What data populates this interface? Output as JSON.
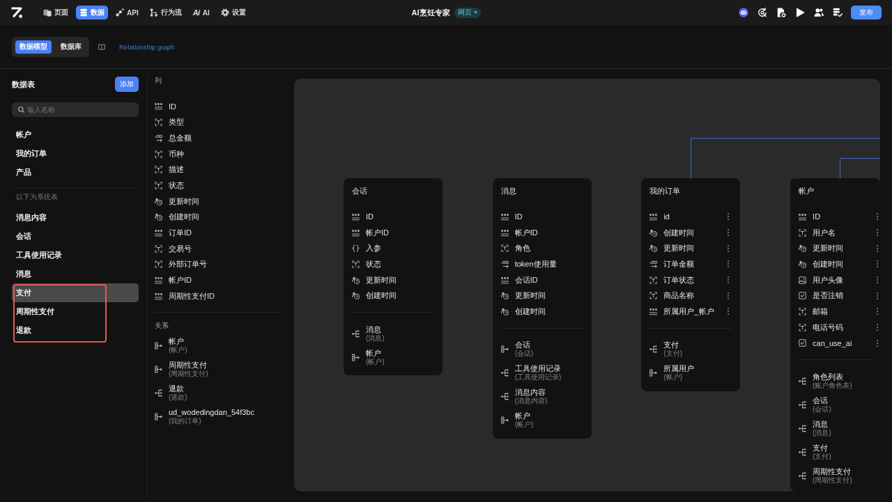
{
  "nav": [
    {
      "kind": "pages",
      "label": "页面",
      "selected": false
    },
    {
      "kind": "data",
      "label": "数据",
      "selected": true
    },
    {
      "kind": "api",
      "label": "API",
      "selected": false
    },
    {
      "kind": "flow",
      "label": "行为流",
      "selected": false
    },
    {
      "kind": "ai",
      "glyph": "Ai",
      "label": "AI",
      "selected": false
    },
    {
      "kind": "settings",
      "label": "设置",
      "selected": false
    }
  ],
  "app": {
    "title": "AI烹饪专家",
    "mode": "网页",
    "publish_button": "发布"
  },
  "view_switch": [
    {
      "label": "数据模型",
      "selected": true
    },
    {
      "label": "数据库",
      "selected": false
    }
  ],
  "graph_link": "Relationship graph",
  "sidebar": {
    "title": "数据表",
    "add_button": "添加",
    "search_placeholder": "输入名称",
    "tables": [
      {
        "label": "帐户",
        "selected": false,
        "highlighted": false
      },
      {
        "label": "我的订单",
        "selected": false,
        "highlighted": false
      },
      {
        "label": "产品",
        "selected": false,
        "highlighted": false
      }
    ],
    "system_label": "以下为系统表",
    "system_tables": [
      {
        "label": "消息内容",
        "selected": false,
        "highlighted": false
      },
      {
        "label": "会话",
        "selected": false,
        "highlighted": false
      },
      {
        "label": "工具使用记录",
        "selected": false,
        "highlighted": false
      },
      {
        "label": "消息",
        "selected": false,
        "highlighted": false
      },
      {
        "label": "支付",
        "selected": true,
        "highlighted": true
      },
      {
        "label": "周期性支付",
        "selected": false,
        "highlighted": true
      },
      {
        "label": "退款",
        "selected": false,
        "highlighted": true
      }
    ]
  },
  "columns_panel": {
    "title": "列",
    "columns": [
      {
        "kind": "number",
        "name": "ID"
      },
      {
        "kind": "text",
        "name": "类型"
      },
      {
        "kind": "decimal",
        "name": "总金额"
      },
      {
        "kind": "text",
        "name": "币种"
      },
      {
        "kind": "text",
        "name": "描述"
      },
      {
        "kind": "text",
        "name": "状态"
      },
      {
        "kind": "datetime",
        "name": "更新时间"
      },
      {
        "kind": "datetime",
        "name": "创建时间"
      },
      {
        "kind": "number",
        "name": "订单ID"
      },
      {
        "kind": "text",
        "name": "交易号"
      },
      {
        "kind": "text",
        "name": "外部订单号"
      },
      {
        "kind": "number",
        "name": "帐户ID"
      },
      {
        "kind": "number",
        "name": "周期性支付ID"
      }
    ],
    "relations_title": "关系",
    "relations": [
      {
        "kind": "one",
        "name": "帐户",
        "target": "(帐户)"
      },
      {
        "kind": "one",
        "name": "周期性支付",
        "target": "(周期性支付)"
      },
      {
        "kind": "many",
        "name": "退款",
        "target": "(退款)"
      },
      {
        "kind": "one",
        "name": "ud_wodedingdan_54f3bc",
        "target": "(我的订单)"
      }
    ]
  },
  "graph": {
    "cards": [
      {
        "title": "会话",
        "field_menus": false,
        "fields": [
          {
            "kind": "number",
            "name": "ID"
          },
          {
            "kind": "number",
            "name": "帐户ID"
          },
          {
            "kind": "json",
            "name": "入参"
          },
          {
            "kind": "text",
            "name": "状态"
          },
          {
            "kind": "datetime",
            "name": "更新时间"
          },
          {
            "kind": "datetime",
            "name": "创建时间"
          }
        ],
        "relations": [
          {
            "kind": "many",
            "name": "消息",
            "target": "(消息)"
          },
          {
            "kind": "one",
            "name": "帐户",
            "target": "(帐户)"
          }
        ]
      },
      {
        "title": "消息",
        "field_menus": false,
        "fields": [
          {
            "kind": "number",
            "name": "ID"
          },
          {
            "kind": "number",
            "name": "帐户ID"
          },
          {
            "kind": "text",
            "name": "角色"
          },
          {
            "kind": "decimal",
            "name": "token使用量"
          },
          {
            "kind": "number",
            "name": "会话ID"
          },
          {
            "kind": "datetime",
            "name": "更新时间"
          },
          {
            "kind": "datetime",
            "name": "创建时间"
          }
        ],
        "relations": [
          {
            "kind": "one",
            "name": "会话",
            "target": "(会话)"
          },
          {
            "kind": "many",
            "name": "工具使用记录",
            "target": "(工具使用记录)"
          },
          {
            "kind": "many",
            "name": "消息内容",
            "target": "(消息内容)"
          },
          {
            "kind": "one",
            "name": "帐户",
            "target": "(帐户)"
          }
        ]
      },
      {
        "title": "我的订单",
        "field_menus": true,
        "fields": [
          {
            "kind": "number",
            "name": "id"
          },
          {
            "kind": "datetime",
            "name": "创建时间"
          },
          {
            "kind": "datetime",
            "name": "更新时间"
          },
          {
            "kind": "decimal",
            "name": "订单金额"
          },
          {
            "kind": "text",
            "name": "订单状态"
          },
          {
            "kind": "text",
            "name": "商品名称"
          },
          {
            "kind": "number",
            "name": "所属用户_帐户"
          }
        ],
        "relations": [
          {
            "kind": "many",
            "name": "支付",
            "target": "(支付)"
          },
          {
            "kind": "one",
            "name": "所属用户",
            "target": "(帐户)"
          }
        ]
      },
      {
        "title": "帐户",
        "field_menus": true,
        "fields": [
          {
            "kind": "number",
            "name": "ID"
          },
          {
            "kind": "text",
            "name": "用户名"
          },
          {
            "kind": "datetime",
            "name": "更新时间"
          },
          {
            "kind": "datetime",
            "name": "创建时间"
          },
          {
            "kind": "image",
            "name": "用户头像"
          },
          {
            "kind": "boolean",
            "name": "是否注销"
          },
          {
            "kind": "text",
            "name": "邮箱"
          },
          {
            "kind": "text",
            "name": "电话号码"
          },
          {
            "kind": "boolean",
            "name": "can_use_ai"
          }
        ],
        "relations": [
          {
            "kind": "many",
            "name": "角色列表",
            "target": "(账户角色表)"
          },
          {
            "kind": "many",
            "name": "会话",
            "target": "(会话)"
          },
          {
            "kind": "many",
            "name": "消息",
            "target": "(消息)"
          },
          {
            "kind": "many",
            "name": "支付",
            "target": "(支付)"
          },
          {
            "kind": "many",
            "name": "周期性支付",
            "target": "(周期性支付)"
          }
        ]
      }
    ]
  }
}
